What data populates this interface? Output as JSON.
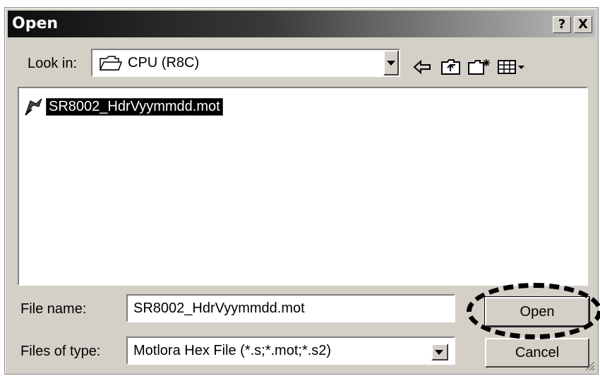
{
  "window": {
    "title": "Open",
    "help_label": "?",
    "close_label": "X"
  },
  "look_in": {
    "label": "Look in:",
    "folder_icon": "folder-icon",
    "value": "CPU (R8C)"
  },
  "toolbar": {
    "icons": [
      "back-arrow-icon",
      "up-folder-icon",
      "new-folder-icon",
      "view-menu-icon"
    ]
  },
  "files": [
    {
      "name": "SR8002_HdrVyymmdd.mot",
      "icon": "mot-file-icon",
      "selected": true
    }
  ],
  "file_name": {
    "label": "File name:",
    "value": "SR8002_HdrVyymmdd.mot"
  },
  "file_type": {
    "label": "Files of type:",
    "value": "Motlora Hex File (*.s;*.mot;*.s2)"
  },
  "buttons": {
    "open_label": "Open",
    "cancel_label": "Cancel"
  },
  "colors": {
    "dialog_bg": "#d4d0c8",
    "title_start": "#0d0d0d",
    "title_end": "#bdbdbd",
    "selection": "#000000"
  }
}
